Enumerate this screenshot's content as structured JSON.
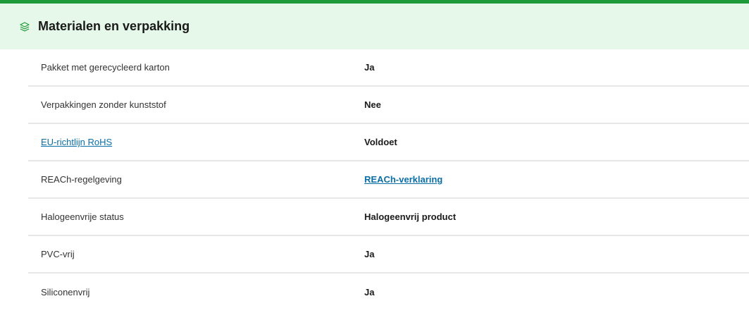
{
  "section": {
    "title": "Materialen en verpakking",
    "icon": "layers-icon",
    "accent_color": "#1f9a3a",
    "header_background": "#e6f8e9",
    "link_color": "#0b6fa6"
  },
  "rows": [
    {
      "label": "Pakket met gerecycleerd karton",
      "value": "Ja"
    },
    {
      "label": "Verpakkingen zonder kunststof",
      "value": "Nee"
    },
    {
      "label": "EU-richtlijn RoHS",
      "value": "Voldoet"
    },
    {
      "label": "REACh-regelgeving",
      "value": "REACh-verklaring"
    },
    {
      "label": "Halogeenvrije status",
      "value": "Halogeenvrij product"
    },
    {
      "label": "PVC-vrij",
      "value": "Ja"
    },
    {
      "label": "Siliconenvrij",
      "value": "Ja"
    }
  ]
}
